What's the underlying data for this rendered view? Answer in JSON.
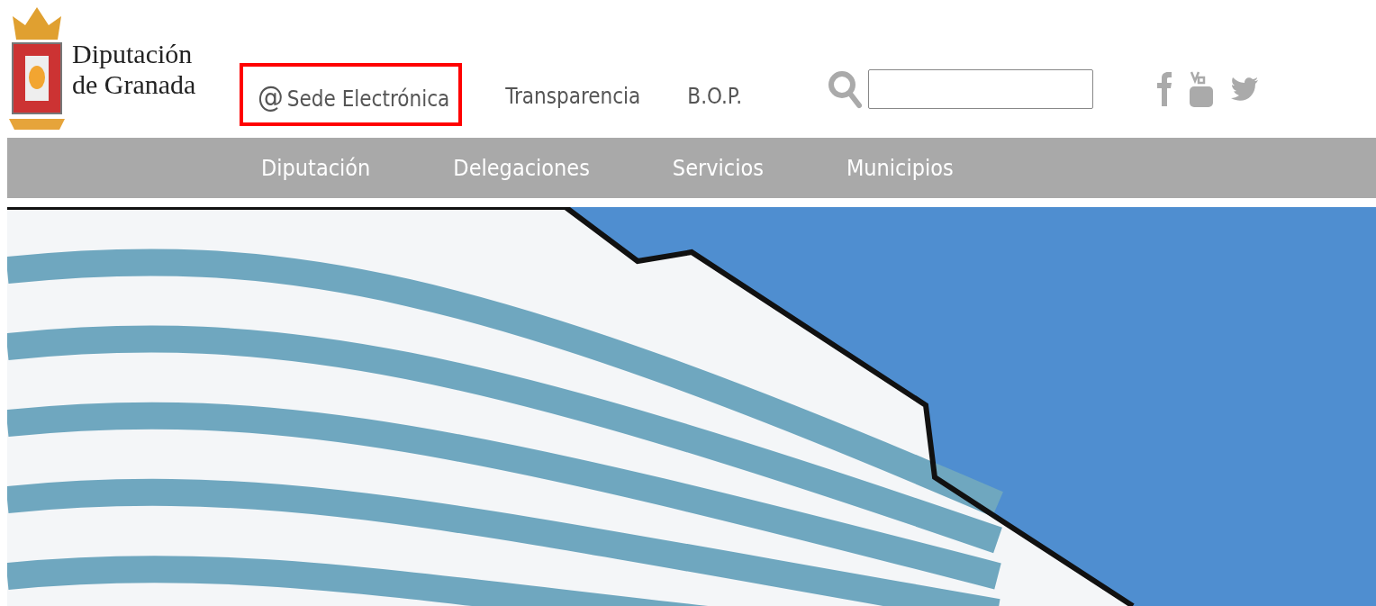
{
  "logo": {
    "line_1": "Diputación",
    "line_2": "de Granada"
  },
  "top_links": [
    {
      "label": "Sede Electrónica",
      "kind": "at",
      "icon_text": "@",
      "highlighted": true
    },
    {
      "label": "Transparencia",
      "kind": "plain",
      "highlighted": false
    },
    {
      "label": "B.O.P.",
      "kind": "plain",
      "highlighted": false
    }
  ],
  "nav": [
    "Diputación",
    "Delegaciones",
    "Servicios",
    "Municipios"
  ]
}
